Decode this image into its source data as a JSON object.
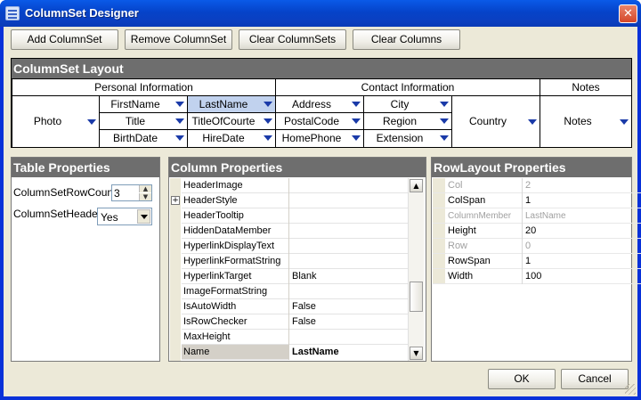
{
  "window": {
    "title": "ColumnSet Designer",
    "close_glyph": "✕"
  },
  "toolbar": {
    "add": "Add ColumnSet",
    "remove": "Remove ColumnSet",
    "clear_sets": "Clear ColumnSets",
    "clear_cols": "Clear Columns"
  },
  "layout": {
    "title": "ColumnSet Layout",
    "groups": {
      "personal": "Personal Information",
      "contact": "Contact Information",
      "notes": "Notes"
    },
    "cells": {
      "photo": "Photo",
      "firstname": "FirstName",
      "lastname": "LastName",
      "title": "Title",
      "titleofcourtesy": "TitleOfCourte",
      "birthdate": "BirthDate",
      "hiredate": "HireDate",
      "address": "Address",
      "city": "City",
      "postalcode": "PostalCode",
      "region": "Region",
      "homephone": "HomePhone",
      "extension": "Extension",
      "country": "Country",
      "notes": "Notes"
    },
    "selected_cell": "lastname",
    "dropdown_icon": "triangle-down-icon"
  },
  "table_props": {
    "title": "Table Properties",
    "rowcount_label": "ColumnSetRowCount",
    "rowcount_value": "3",
    "header_label": "ColumnSetHeader",
    "header_value": "Yes"
  },
  "column_props": {
    "title": "Column Properties",
    "expand_icon": "plus-box-icon",
    "rows": [
      {
        "name": "HeaderImage",
        "value": ""
      },
      {
        "name": "HeaderStyle",
        "value": ""
      },
      {
        "name": "HeaderTooltip",
        "value": ""
      },
      {
        "name": "HiddenDataMember",
        "value": ""
      },
      {
        "name": "HyperlinkDisplayText",
        "value": ""
      },
      {
        "name": "HyperlinkFormatString",
        "value": ""
      },
      {
        "name": "HyperlinkTarget",
        "value": "Blank"
      },
      {
        "name": "ImageFormatString",
        "value": ""
      },
      {
        "name": "IsAutoWidth",
        "value": "False"
      },
      {
        "name": "IsRowChecker",
        "value": "False"
      },
      {
        "name": "MaxHeight",
        "value": ""
      },
      {
        "name": "Name",
        "value": "LastName"
      }
    ],
    "scroll_position": 0.72
  },
  "rowlayout_props": {
    "title": "RowLayout Properties",
    "rows": [
      {
        "name": "Col",
        "value": "2",
        "disabled": true
      },
      {
        "name": "ColSpan",
        "value": "1",
        "disabled": false
      },
      {
        "name": "ColumnMember",
        "value": "LastName",
        "disabled": true
      },
      {
        "name": "Height",
        "value": "20",
        "disabled": false
      },
      {
        "name": "Row",
        "value": "0",
        "disabled": true
      },
      {
        "name": "RowSpan",
        "value": "1",
        "disabled": false
      },
      {
        "name": "Width",
        "value": "100",
        "disabled": false
      }
    ]
  },
  "footer": {
    "ok": "OK",
    "cancel": "Cancel"
  },
  "colors": {
    "title_bar": "#0a4fd8",
    "panel_header": "#6e6e6e",
    "selected_cell": "#c1d2ee",
    "dropdown_arrow": "#1a3aa8"
  }
}
